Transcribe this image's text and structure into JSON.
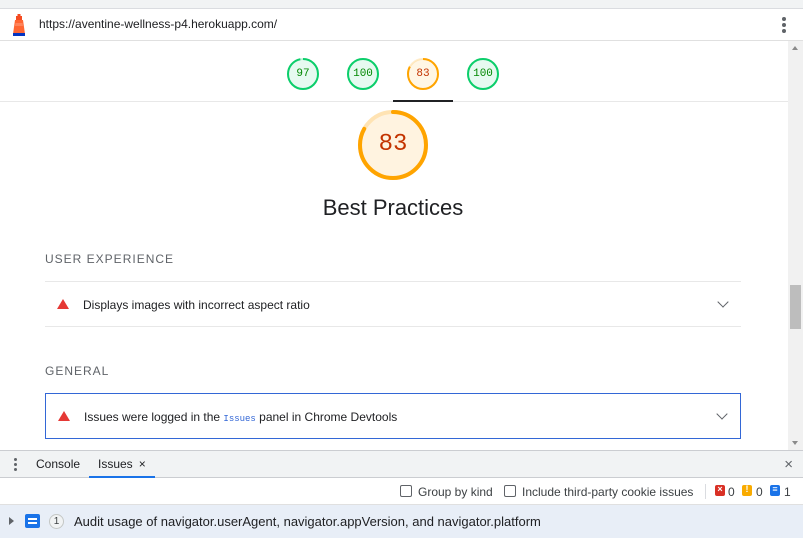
{
  "browser": {
    "url": "https://aventine-wellness-p4.herokuapp.com/"
  },
  "gauges": [
    {
      "score": "97",
      "color": "#0cce6b"
    },
    {
      "score": "100",
      "color": "#0cce6b"
    },
    {
      "score": "83",
      "color": "#ffa400",
      "selected": true
    },
    {
      "score": "100",
      "color": "#0cce6b"
    }
  ],
  "category": {
    "score": "83",
    "score_fraction": 0.83,
    "color": "#ffa400",
    "title": "Best Practices"
  },
  "groups": [
    {
      "title": "USER EXPERIENCE",
      "audits": [
        {
          "text": "Displays images with incorrect aspect ratio",
          "status": "fail"
        }
      ]
    },
    {
      "title": "GENERAL",
      "audits": [
        {
          "text_before": "Issues were logged in the ",
          "code": "Issues",
          "text_after": " panel in Chrome Devtools",
          "status": "fail"
        }
      ]
    }
  ],
  "drawer": {
    "tabs": [
      {
        "label": "Console",
        "active": false
      },
      {
        "label": "Issues",
        "active": true,
        "close_glyph": "×"
      }
    ],
    "close_glyph": "×"
  },
  "issues_toolbar": {
    "group_by_kind": "Group by kind",
    "third_party": "Include third-party cookie issues",
    "counts": {
      "errors": "0",
      "warnings": "0",
      "info": "1"
    }
  },
  "issue": {
    "count": "1",
    "text": "Audit usage of navigator.userAgent, navigator.appVersion, and navigator.platform"
  }
}
